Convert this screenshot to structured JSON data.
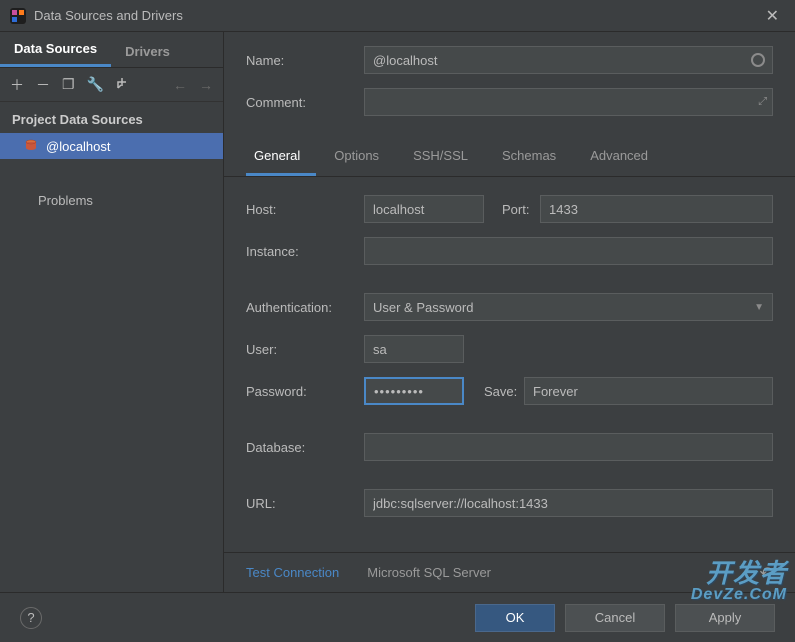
{
  "window": {
    "title": "Data Sources and Drivers"
  },
  "sidebar": {
    "tabs": [
      {
        "label": "Data Sources",
        "active": true
      },
      {
        "label": "Drivers",
        "active": false
      }
    ],
    "heading": "Project Data Sources",
    "items": [
      {
        "label": "@localhost",
        "selected": true
      }
    ],
    "problems_label": "Problems"
  },
  "form": {
    "name_label": "Name:",
    "name_value": "@localhost",
    "comment_label": "Comment:",
    "comment_value": ""
  },
  "detail_tabs": [
    {
      "label": "General",
      "active": true
    },
    {
      "label": "Options",
      "active": false
    },
    {
      "label": "SSH/SSL",
      "active": false
    },
    {
      "label": "Schemas",
      "active": false
    },
    {
      "label": "Advanced",
      "active": false
    }
  ],
  "general": {
    "host_label": "Host:",
    "host_value": "localhost",
    "port_label": "Port:",
    "port_value": "1433",
    "instance_label": "Instance:",
    "instance_value": "",
    "auth_label": "Authentication:",
    "auth_value": "User & Password",
    "user_label": "User:",
    "user_value": "sa",
    "password_label": "Password:",
    "password_value": "•••••••••",
    "save_label": "Save:",
    "save_value": "Forever",
    "database_label": "Database:",
    "database_value": "",
    "url_label": "URL:",
    "url_value": "jdbc:sqlserver://localhost:1433"
  },
  "footer": {
    "test_label": "Test Connection",
    "driver_name": "Microsoft SQL Server"
  },
  "buttons": {
    "ok": "OK",
    "cancel": "Cancel",
    "apply": "Apply"
  },
  "watermark": {
    "line1": "开发者",
    "line2": "DevZe.CoM"
  }
}
